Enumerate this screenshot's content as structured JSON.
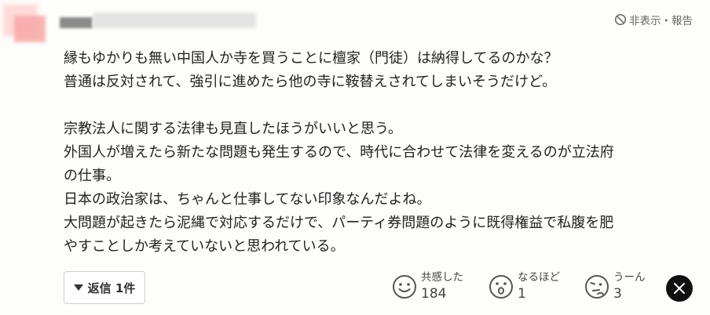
{
  "comment": {
    "report_label": "非表示・報告",
    "lines": [
      "縁もゆかりも無い中国人か寺を買うことに檀家（門徒）は納得してるのかな？",
      "普通は反対されて、強引に進めたら他の寺に鞍替えされてしまいそうだけど。",
      "宗教法人に関する法律も見直したほうがいいと思う。",
      "外国人が増えたら新たな問題も発生するので、時代に合わせて法律を変えるのが立法府",
      "の仕事。",
      "日本の政治家は、ちゃんと仕事してない印象なんだよね。",
      "大問題が起きたら泥縄で対応するだけで、パーティ券問題のように既得権益で私腹を肥",
      "やすことしか考えていないと思われている。"
    ]
  },
  "actions": {
    "reply_label": "返信 1件",
    "reactions": [
      {
        "icon": "smile-icon",
        "label": "共感した",
        "count": "184"
      },
      {
        "icon": "surprised-face-icon",
        "label": "なるほど",
        "count": "1"
      },
      {
        "icon": "thinking-face-icon",
        "label": "うーん",
        "count": "3"
      }
    ],
    "share_icon": "x-logo-icon"
  }
}
